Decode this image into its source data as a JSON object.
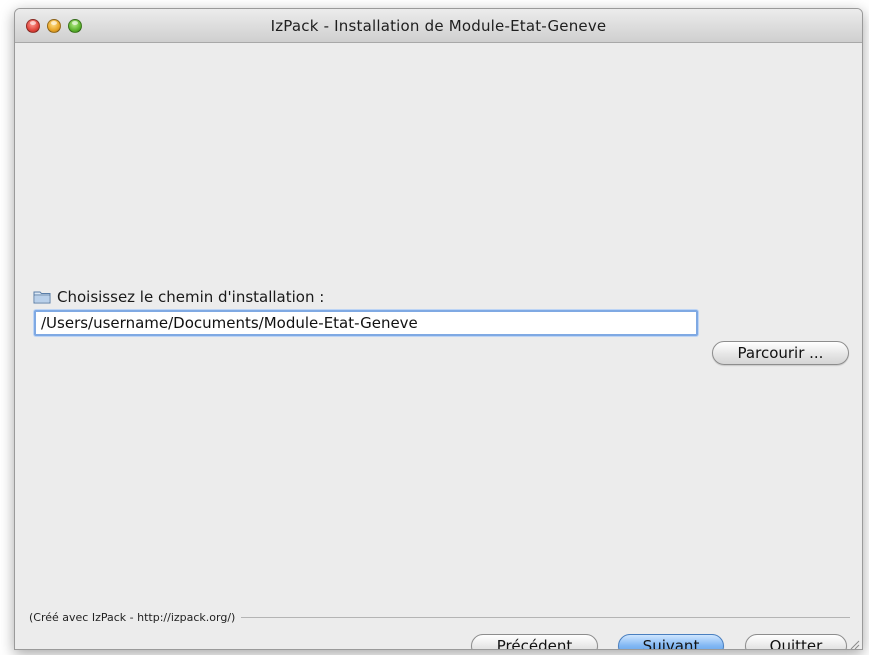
{
  "window": {
    "title": "IzPack - Installation de Module-Etat-Geneve"
  },
  "target_panel": {
    "label": "Choisissez le chemin d'installation :",
    "path_value": "/Users/username/Documents/Module-Etat-Geneve",
    "browse_label": "Parcourir ..."
  },
  "footer": {
    "credit": "(Créé avec IzPack - http://izpack.org/)",
    "previous_label": "Précédent",
    "next_label": "Suivant",
    "quit_label": "Quitter"
  },
  "icons": {
    "folder": "folder-icon",
    "close": "window-close-icon",
    "minimize": "window-minimize-icon",
    "zoom": "window-zoom-icon",
    "resize": "resize-grip-icon"
  },
  "colors": {
    "window_bg": "#ececec",
    "focus_ring": "#7fa9e3",
    "default_button": "#7fb6f3",
    "close_button": "#e0443b",
    "minimize_button": "#e8a526",
    "zoom_button": "#5cb32d"
  }
}
